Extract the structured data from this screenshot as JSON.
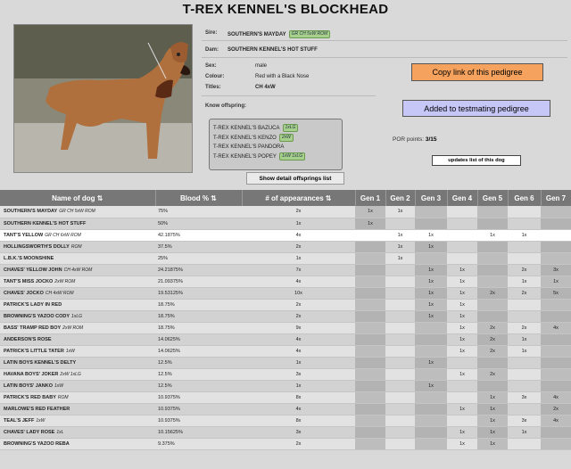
{
  "title": "T-REX KENNEL'S BLOCKHEAD",
  "sire": {
    "label": "Sire:",
    "name": "SOUTHERN'S MAYDAY",
    "badge": "GR CH 5xW ROM"
  },
  "dam": {
    "label": "Dam:",
    "name": "SOUTHERN KENNEL'S HOT STUFF"
  },
  "sex": {
    "label": "Sex:",
    "value": "male"
  },
  "colour": {
    "label": "Colour:",
    "value": "Red with a Black Nose"
  },
  "titles": {
    "label": "Titles:",
    "value": "CH 4xW"
  },
  "offspring": {
    "label": "Know offspring:",
    "items": [
      {
        "name": "T-REX KENNEL'S BAZUCA",
        "badge": "1xLG"
      },
      {
        "name": "T-REX KENNEL'S KENZO",
        "badge": "2xW"
      },
      {
        "name": "T-REX KENNEL'S PANDORA",
        "badge": ""
      },
      {
        "name": "T-REX KENNEL'S POPEY",
        "badge": "1xW 1xLG"
      }
    ],
    "show_label": "Show detail offsprings list"
  },
  "buttons": {
    "copy_link": "Copy link of this pedigree",
    "add_testmating": "Added to testmating pedigree",
    "updates": "updates list of this dog"
  },
  "por": {
    "label": "POR points:",
    "value": "3/15"
  },
  "table": {
    "headers": [
      "Name of dog ⇅",
      "Blood % ⇅",
      "# of appearances ⇅",
      "Gen 1",
      "Gen 2",
      "Gen 3",
      "Gen 4",
      "Gen 5",
      "Gen 6",
      "Gen 7"
    ],
    "rows": [
      {
        "name": "SOUTHERN'S MAYDAY",
        "tag": "GR CH 5xW ROM",
        "blood": "75%",
        "app": "2x",
        "gens": [
          "1x",
          "1x",
          "",
          "",
          "",
          "",
          ""
        ]
      },
      {
        "name": "SOUTHERN KENNEL'S HOT STUFF",
        "tag": "",
        "blood": "50%",
        "app": "1x",
        "gens": [
          "1x",
          "",
          "",
          "",
          "",
          "",
          ""
        ]
      },
      {
        "name": "TANT'S YELLOW",
        "tag": "GR CH 6xW ROM",
        "blood": "42.1875%",
        "app": "4x",
        "gens": [
          "",
          "1x",
          "1x",
          "",
          "1x",
          "1x",
          ""
        ]
      },
      {
        "name": "HOLLINGSWORTH'S DOLLY",
        "tag": "ROM",
        "blood": "37.5%",
        "app": "2x",
        "gens": [
          "",
          "1x",
          "1x",
          "",
          "",
          "",
          ""
        ]
      },
      {
        "name": "L.B.K.'S MOONSHINE",
        "tag": "",
        "blood": "25%",
        "app": "1x",
        "gens": [
          "",
          "1x",
          "",
          "",
          "",
          "",
          ""
        ]
      },
      {
        "name": "CHAVES' YELLOW JOHN",
        "tag": "CH 4xW ROM",
        "blood": "24.21875%",
        "app": "7x",
        "gens": [
          "",
          "",
          "1x",
          "1x",
          "",
          "2x",
          "3x"
        ]
      },
      {
        "name": "TANT'S MISS JOCKO",
        "tag": "2xW ROM",
        "blood": "21.09375%",
        "app": "4x",
        "gens": [
          "",
          "",
          "1x",
          "1x",
          "",
          "1x",
          "1x"
        ]
      },
      {
        "name": "CHAVES' JOCKO",
        "tag": "CH 4xW ROM",
        "blood": "19.53125%",
        "app": "10x",
        "gens": [
          "",
          "",
          "1x",
          "1x",
          "2x",
          "2x",
          "5x"
        ]
      },
      {
        "name": "PATRICK'S LADY IN RED",
        "tag": "",
        "blood": "18.75%",
        "app": "2x",
        "gens": [
          "",
          "",
          "1x",
          "1x",
          "",
          "",
          ""
        ]
      },
      {
        "name": "BROWNING'S YAZOO CODY",
        "tag": "1xLG",
        "blood": "18.75%",
        "app": "2x",
        "gens": [
          "",
          "",
          "1x",
          "1x",
          "",
          "",
          ""
        ]
      },
      {
        "name": "BASS' TRAMP RED BOY",
        "tag": "2xW ROM",
        "blood": "18.75%",
        "app": "9x",
        "gens": [
          "",
          "",
          "",
          "1x",
          "2x",
          "2x",
          "4x"
        ]
      },
      {
        "name": "ANDERSON'S ROSE",
        "tag": "",
        "blood": "14.0625%",
        "app": "4x",
        "gens": [
          "",
          "",
          "",
          "1x",
          "2x",
          "1x",
          ""
        ]
      },
      {
        "name": "PATRICK'S LITTLE TATER",
        "tag": "1xW",
        "blood": "14.0625%",
        "app": "4x",
        "gens": [
          "",
          "",
          "",
          "1x",
          "2x",
          "1x",
          ""
        ]
      },
      {
        "name": "LATIN BOYS KENNEL'S DELTY",
        "tag": "",
        "blood": "12.5%",
        "app": "1x",
        "gens": [
          "",
          "",
          "1x",
          "",
          "",
          "",
          ""
        ]
      },
      {
        "name": "HAVANA BOYS' JOKER",
        "tag": "2xW 1xLG",
        "blood": "12.5%",
        "app": "3x",
        "gens": [
          "",
          "",
          "",
          "1x",
          "2x",
          "",
          ""
        ]
      },
      {
        "name": "LATIN BOYS' JANKO",
        "tag": "1xW",
        "blood": "12.5%",
        "app": "1x",
        "gens": [
          "",
          "",
          "1x",
          "",
          "",
          "",
          ""
        ]
      },
      {
        "name": "PATRICK'S RED BABY",
        "tag": "ROM",
        "blood": "10.9375%",
        "app": "8x",
        "gens": [
          "",
          "",
          "",
          "",
          "1x",
          "3x",
          "4x"
        ]
      },
      {
        "name": "MARLOWE'S RED FEATHER",
        "tag": "",
        "blood": "10.9375%",
        "app": "4x",
        "gens": [
          "",
          "",
          "",
          "1x",
          "1x",
          "",
          "2x"
        ]
      },
      {
        "name": "TEAL'S JEFF",
        "tag": "1xW",
        "blood": "10.9375%",
        "app": "8x",
        "gens": [
          "",
          "",
          "",
          "",
          "1x",
          "3x",
          "4x"
        ]
      },
      {
        "name": "CHAVES' LADY ROSE",
        "tag": "1xL",
        "blood": "10.15625%",
        "app": "3x",
        "gens": [
          "",
          "",
          "",
          "1x",
          "1x",
          "1x",
          ""
        ]
      },
      {
        "name": "BROWNING'S YAZOO REBA",
        "tag": "",
        "blood": "9.375%",
        "app": "2x",
        "gens": [
          "",
          "",
          "",
          "1x",
          "1x",
          "",
          ""
        ]
      }
    ]
  }
}
